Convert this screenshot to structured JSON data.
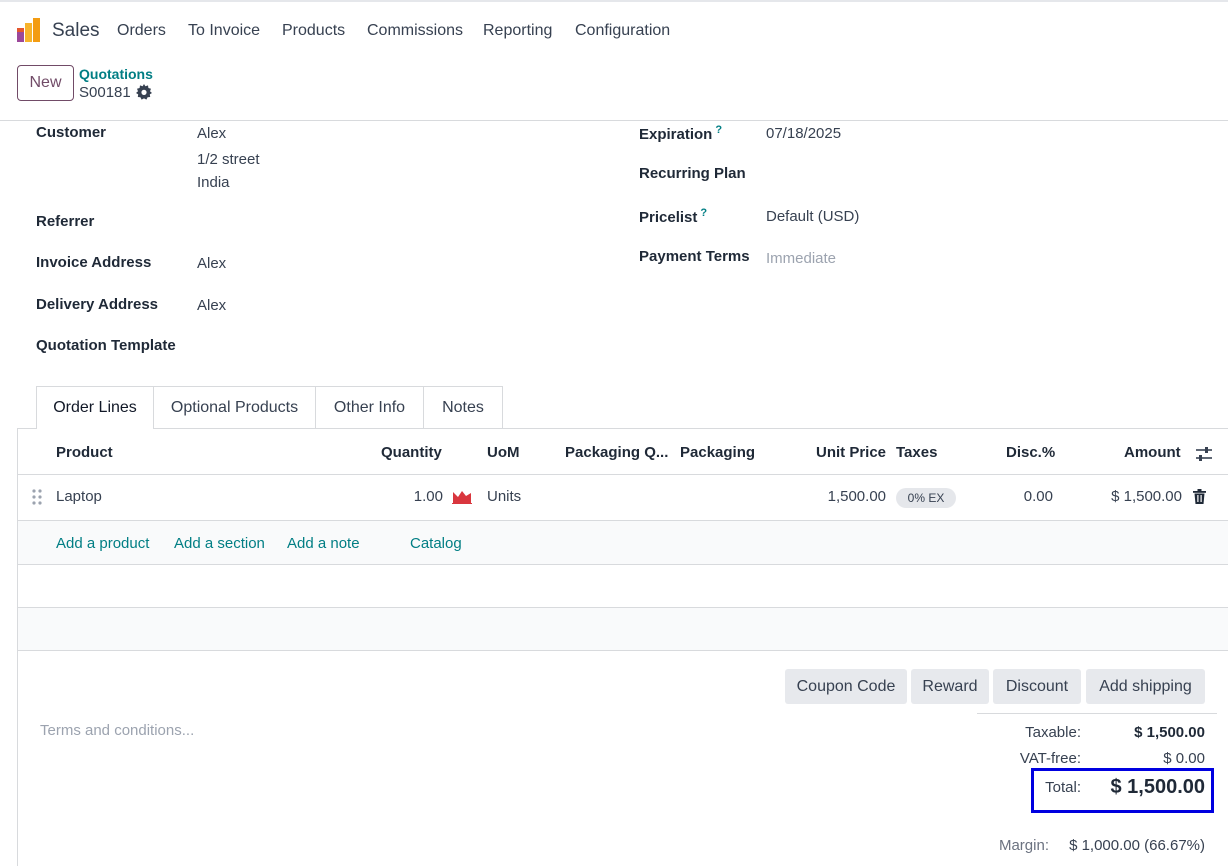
{
  "nav": {
    "app_title": "Sales",
    "menu": [
      "Orders",
      "To Invoice",
      "Products",
      "Commissions",
      "Reporting",
      "Configuration"
    ]
  },
  "control": {
    "new_label": "New",
    "breadcrumb_parent": "Quotations",
    "record_name": "S00181"
  },
  "form": {
    "left": {
      "customer_label": "Customer",
      "customer_name": "Alex",
      "customer_street": "1/2 street",
      "customer_country": "India",
      "referrer_label": "Referrer",
      "invoice_address_label": "Invoice Address",
      "invoice_address": "Alex",
      "delivery_address_label": "Delivery Address",
      "delivery_address": "Alex",
      "quotation_template_label": "Quotation Template"
    },
    "right": {
      "expiration_label": "Expiration",
      "expiration": "07/18/2025",
      "recurring_plan_label": "Recurring Plan",
      "pricelist_label": "Pricelist",
      "pricelist": "Default (USD)",
      "payment_terms_label": "Payment Terms",
      "payment_terms_placeholder": "Immediate"
    },
    "help_mark": "?"
  },
  "tabs": [
    "Order Lines",
    "Optional Products",
    "Other Info",
    "Notes"
  ],
  "table": {
    "columns": {
      "product": "Product",
      "quantity": "Quantity",
      "uom": "UoM",
      "packaging_qty": "Packaging Q...",
      "packaging": "Packaging",
      "unit_price": "Unit Price",
      "taxes": "Taxes",
      "disc": "Disc.%",
      "amount": "Amount"
    },
    "rows": [
      {
        "product": "Laptop",
        "quantity": "1.00",
        "uom": "Units",
        "unit_price": "1,500.00",
        "tax": "0% EX",
        "disc": "0.00",
        "amount": "$ 1,500.00"
      }
    ],
    "add_product": "Add a product",
    "add_section": "Add a section",
    "add_note": "Add a note",
    "catalog": "Catalog"
  },
  "actions": [
    "Coupon Code",
    "Reward",
    "Discount",
    "Add shipping"
  ],
  "terms_placeholder": "Terms and conditions...",
  "totals": {
    "taxable_label": "Taxable:",
    "taxable": "$ 1,500.00",
    "vat_free_label": "VAT-free:",
    "vat_free": "$ 0.00",
    "total_label": "Total:",
    "total": "$ 1,500.00",
    "margin_label": "Margin:",
    "margin": "$ 1,000.00 (66.67%)"
  },
  "colors": {
    "brand": "#714b67",
    "link": "#017e84",
    "highlight_box": "#0000e0",
    "forecast_icon": "#d9363e"
  }
}
